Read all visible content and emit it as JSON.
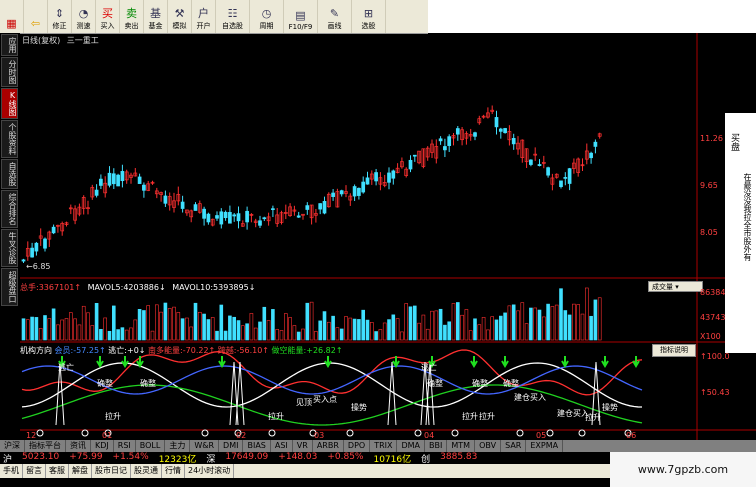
{
  "toolbar": {
    "buttons": [
      {
        "label": "",
        "icon": "grid-icon"
      },
      {
        "label": "",
        "icon": "back-arrow-icon"
      },
      {
        "label": "修正",
        "icon": "arrows-updown-icon"
      },
      {
        "label": "测速",
        "icon": "speedometer-icon"
      },
      {
        "label": "买入",
        "icon": "buy-icon"
      },
      {
        "label": "卖出",
        "icon": "sell-icon"
      },
      {
        "label": "基金",
        "icon": "fund-icon"
      },
      {
        "label": "模拟",
        "icon": "hammer-icon"
      },
      {
        "label": "开户",
        "icon": "account-icon"
      },
      {
        "label": "自选股",
        "icon": "watchlist-icon"
      },
      {
        "label": "周期",
        "icon": "clock-icon"
      },
      {
        "label": "F10/F9",
        "icon": "f10-icon"
      },
      {
        "label": "画线",
        "icon": "pencil-icon"
      },
      {
        "label": "选股",
        "icon": "stock-picker-icon"
      }
    ]
  },
  "sidebar": {
    "items": [
      "应用",
      "分时图",
      "K线图",
      "个股资料",
      "自选股",
      "综合排名",
      "牛叉诊股",
      "超级盘口"
    ],
    "active": 2
  },
  "chart": {
    "header": "日线(复权)",
    "stock_name": "三一重工",
    "low_marker": "6.85",
    "price_axis": [
      "11.26",
      "9.65",
      "8.05"
    ]
  },
  "volume": {
    "label_total": "总手:",
    "total": "3367101",
    "mavol5_label": "MAVOL5:",
    "mavol5": "4203886",
    "mavol10_label": "MAVOL10:",
    "mavol10": "5393895",
    "dropdown": "成交量",
    "axis": [
      "86384",
      "43743",
      "X100"
    ]
  },
  "indicator": {
    "name": "机构方向",
    "items": [
      {
        "label": "会员:",
        "value": "-57.25"
      },
      {
        "label": "逃亡:",
        "value": "+0"
      },
      {
        "label": "南多能量:",
        "value": "-70.22"
      },
      {
        "label": "跨越:",
        "value": "-56.10"
      },
      {
        "label": "做空能量:",
        "value": "+26.82"
      }
    ],
    "button": "指标说明",
    "axis": [
      "100.0",
      "50.43"
    ],
    "annotations": [
      "逃亡",
      "确整",
      "确整",
      "拉升",
      "见顶",
      "买入点",
      "操势",
      "拉升",
      "逃亡",
      "确整",
      "确整",
      "确整",
      "拉升",
      "拉升",
      "建仓买入",
      "建仓买入",
      "拉升",
      "操势"
    ],
    "dates": [
      "12",
      "01",
      "02",
      "03",
      "04",
      "05",
      "06"
    ]
  },
  "tabs": [
    "沪深",
    "指标平台",
    "资讯",
    "KDJ",
    "RSI",
    "BOLL",
    "主力",
    "W&R",
    "DMI",
    "BIAS",
    "ASI",
    "VR",
    "ARBR",
    "DPO",
    "TRIX",
    "DMA",
    "BBI",
    "MTM",
    "OBV",
    "SAR",
    "EXPMA"
  ],
  "quote": {
    "market1": "沪",
    "index1": "5023.10",
    "change1": "+75.99",
    "pct1": "+1.54%",
    "amount1": "12323亿",
    "market2": "深",
    "index2": "17649.09",
    "change2": "+148.03",
    "pct2": "+0.85%",
    "amount2": "10716亿",
    "market3": "创",
    "index3": "3885.83"
  },
  "status": [
    "手机",
    "留言",
    "客服",
    "解盘",
    "股市日记",
    "股灵通",
    "行情",
    "24小时滚动"
  ],
  "right_panel": {
    "col1": "买盘",
    "col2": "在最没没我拉全市股外有"
  },
  "watermark": "www.7gpzb.com",
  "colors": {
    "up": "#ff3030",
    "down": "#40e0ff",
    "yellow": "#ffff00",
    "green": "#20c020"
  }
}
